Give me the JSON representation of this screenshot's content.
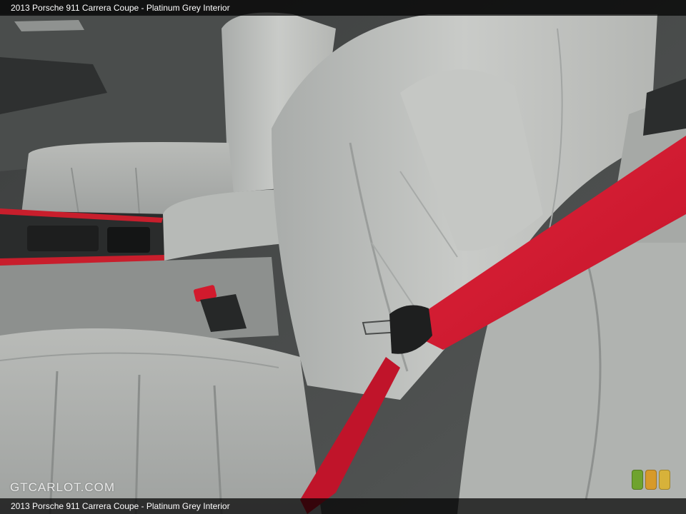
{
  "caption_top": "2013 Porsche 911 Carrera Coupe - Platinum Grey Interior",
  "caption_bottom": "2013 Porsche 911 Carrera Coupe - Platinum Grey Interior",
  "watermark": "GTCARLOT.COM",
  "colors": {
    "leather": "#c9cbc8",
    "belt_red": "#d8182a",
    "trim_red": "#c81e2c",
    "badge": [
      "#6fa32e",
      "#d79a2a",
      "#d7b23a"
    ]
  }
}
